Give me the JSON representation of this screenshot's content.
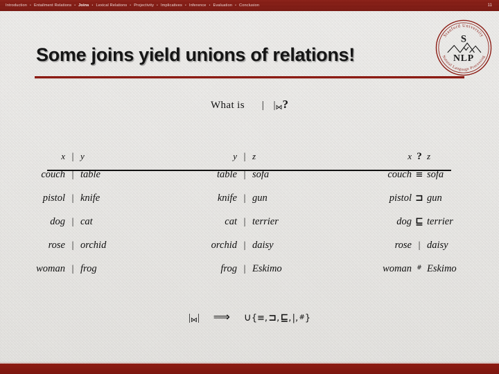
{
  "topbar": {
    "items": [
      {
        "label": "Introduction",
        "current": false
      },
      {
        "label": "Entailment Relations",
        "current": false
      },
      {
        "label": "Joins",
        "current": true
      },
      {
        "label": "Lexical Relations",
        "current": false
      },
      {
        "label": "Projectivity",
        "current": false
      },
      {
        "label": "Implicatives",
        "current": false
      },
      {
        "label": "Inference",
        "current": false
      },
      {
        "label": "Evaluation",
        "current": false
      },
      {
        "label": "Conclusion",
        "current": false
      }
    ],
    "separator": "•",
    "page_number": "11"
  },
  "slide": {
    "title": "Some joins yield unions of relations!",
    "accent_color": "#8b1a12",
    "background_color": "#efeeec"
  },
  "logo": {
    "name": "stanford-nlp-seal",
    "center_letter": "S",
    "acronym": "NLP",
    "arc_top": "Stanford University",
    "arc_bottom": "Natural Language Processing",
    "color": "#8b1a12"
  },
  "question": {
    "prefix": "What is",
    "left_relation": "|",
    "join_symbol": "⋈",
    "right_relation": "|",
    "suffix": "?"
  },
  "tables": {
    "panel1": {
      "header": {
        "left": "x",
        "op": "|",
        "right": "y"
      },
      "rows": [
        {
          "left": "couch",
          "op": "|",
          "right": "table"
        },
        {
          "left": "pistol",
          "op": "|",
          "right": "knife"
        },
        {
          "left": "dog",
          "op": "|",
          "right": "cat"
        },
        {
          "left": "rose",
          "op": "|",
          "right": "orchid"
        },
        {
          "left": "woman",
          "op": "|",
          "right": "frog"
        }
      ]
    },
    "panel2": {
      "header": {
        "left": "y",
        "op": "|",
        "right": "z"
      },
      "rows": [
        {
          "left": "table",
          "op": "|",
          "right": "sofa"
        },
        {
          "left": "knife",
          "op": "|",
          "right": "gun"
        },
        {
          "left": "cat",
          "op": "|",
          "right": "terrier"
        },
        {
          "left": "orchid",
          "op": "|",
          "right": "daisy"
        },
        {
          "left": "frog",
          "op": "|",
          "right": "Eskimo"
        }
      ]
    },
    "panel3": {
      "header": {
        "left": "x",
        "op": "?",
        "right": "z"
      },
      "rows": [
        {
          "left": "couch",
          "op": "≡",
          "right": "sofa"
        },
        {
          "left": "pistol",
          "op": "⊐",
          "right": "gun"
        },
        {
          "left": "dog",
          "op": "⊑",
          "right": "terrier"
        },
        {
          "left": "rose",
          "op": "|",
          "right": "daisy"
        },
        {
          "left": "woman",
          "op": "#",
          "right": "Eskimo"
        }
      ]
    }
  },
  "conclusion": {
    "left_relation": "|",
    "join_symbol": "⋈",
    "right_relation": "|",
    "arrow": "⟹",
    "union_symbol": "∪",
    "open_brace": "{",
    "set_members": [
      "≡",
      "⊐",
      "⊑",
      "|",
      "#"
    ],
    "member_separator": ",",
    "close_brace": "}"
  }
}
